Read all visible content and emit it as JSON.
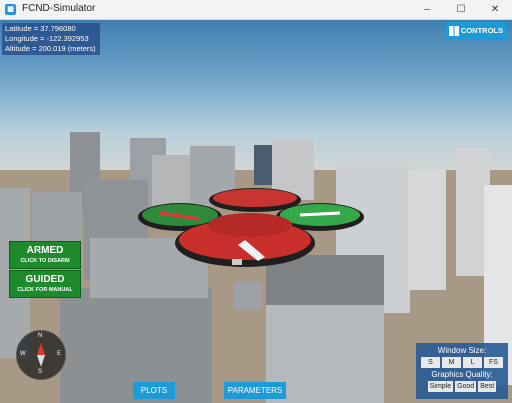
{
  "window": {
    "title": "FCND-Simulator",
    "app_icon": "app-icon",
    "minimize_glyph": "–",
    "maximize_glyph": "☐",
    "close_glyph": "✕"
  },
  "telemetry": {
    "latitude": "Latitude = 37.796080",
    "longitude": "Longitude = -122.392953",
    "altitude": "Altitude = 200.019 (meters)"
  },
  "controls_button": {
    "label": "CONTROLS",
    "icon": "controls-icon"
  },
  "armed_button": {
    "title": "ARMED",
    "subtitle": "CLICK TO DISARM"
  },
  "guided_button": {
    "title": "GUIDED",
    "subtitle": "CLICK FOR MANUAL"
  },
  "bottom_buttons": {
    "plots": "PLOTS",
    "parameters": "PARAMETERS"
  },
  "window_size": {
    "label": "Window Size:",
    "options": [
      "S",
      "M",
      "L",
      "FS"
    ]
  },
  "graphics_quality": {
    "label": "Graphics Quality:",
    "options": [
      "Simple",
      "Good",
      "Best"
    ]
  },
  "compass": {
    "north": "N",
    "south": "S",
    "east": "E",
    "west": "W"
  },
  "colors": {
    "accent": "#1e9bd6",
    "armed_green": "#1f8a2c",
    "panel_blue": "#285a96"
  }
}
